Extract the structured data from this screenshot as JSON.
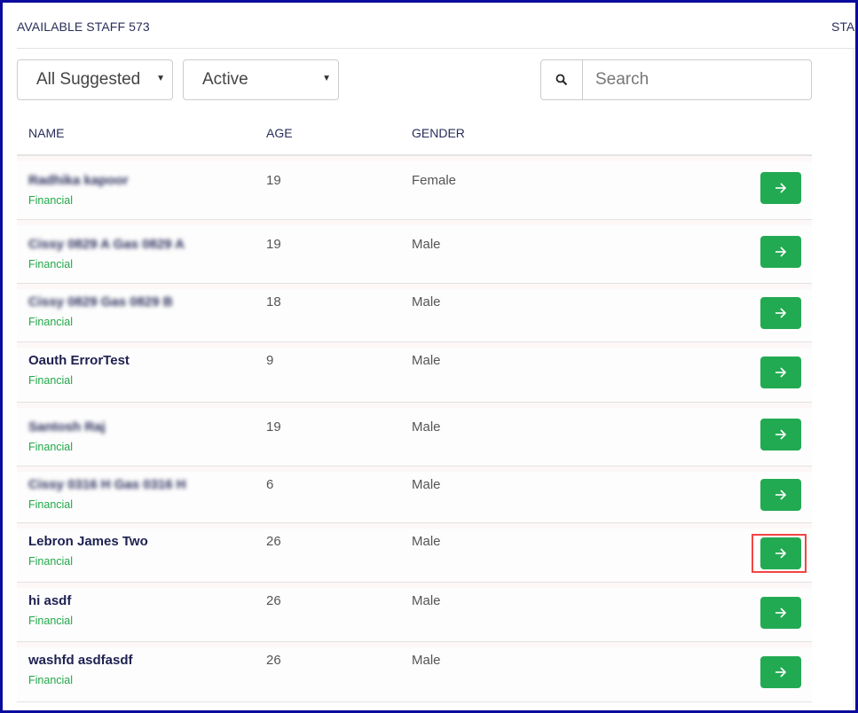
{
  "header": {
    "title": "AVAILABLE STAFF 573",
    "right_title_partial": "STA"
  },
  "filters": {
    "suggested": "All Suggested",
    "status": "Active",
    "search_placeholder": "Search",
    "search_value": ""
  },
  "icons": {
    "search": "search-icon",
    "caret": "caret-down-icon",
    "go": "arrow-right-icon"
  },
  "columns": [
    "NAME",
    "AGE",
    "GENDER"
  ],
  "rows": [
    {
      "name": "Radhika kapoor",
      "dept": "Financial",
      "age": "19",
      "gender": "Female",
      "blurred": true
    },
    {
      "name": "Cissy 0829 A Gas 0829 A",
      "dept": "Financial",
      "age": "19",
      "gender": "Male",
      "blurred": true
    },
    {
      "name": "Cissy 0829 Gas 0829 B",
      "dept": "Financial",
      "age": "18",
      "gender": "Male",
      "blurred": true
    },
    {
      "name": "Oauth ErrorTest",
      "dept": "Financial",
      "age": "9",
      "gender": "Male",
      "blurred": false
    },
    {
      "name": "Santosh Raj",
      "dept": "Financial",
      "age": "19",
      "gender": "Male",
      "blurred": true
    },
    {
      "name": "Cissy 0316 H Gas 0316 H",
      "dept": "Financial",
      "age": "6",
      "gender": "Male",
      "blurred": true
    },
    {
      "name": "Lebron James Two",
      "dept": "Financial",
      "age": "26",
      "gender": "Male",
      "blurred": false,
      "highlighted": true
    },
    {
      "name": "hi asdf",
      "dept": "Financial",
      "age": "26",
      "gender": "Male",
      "blurred": false
    },
    {
      "name": "washfd asdfasdf",
      "dept": "Financial",
      "age": "26",
      "gender": "Male",
      "blurred": false
    }
  ],
  "colors": {
    "accent_green": "#22aa52",
    "highlight": "#f24545",
    "frame": "#0b0b9e",
    "heading": "#2a2d5a"
  }
}
